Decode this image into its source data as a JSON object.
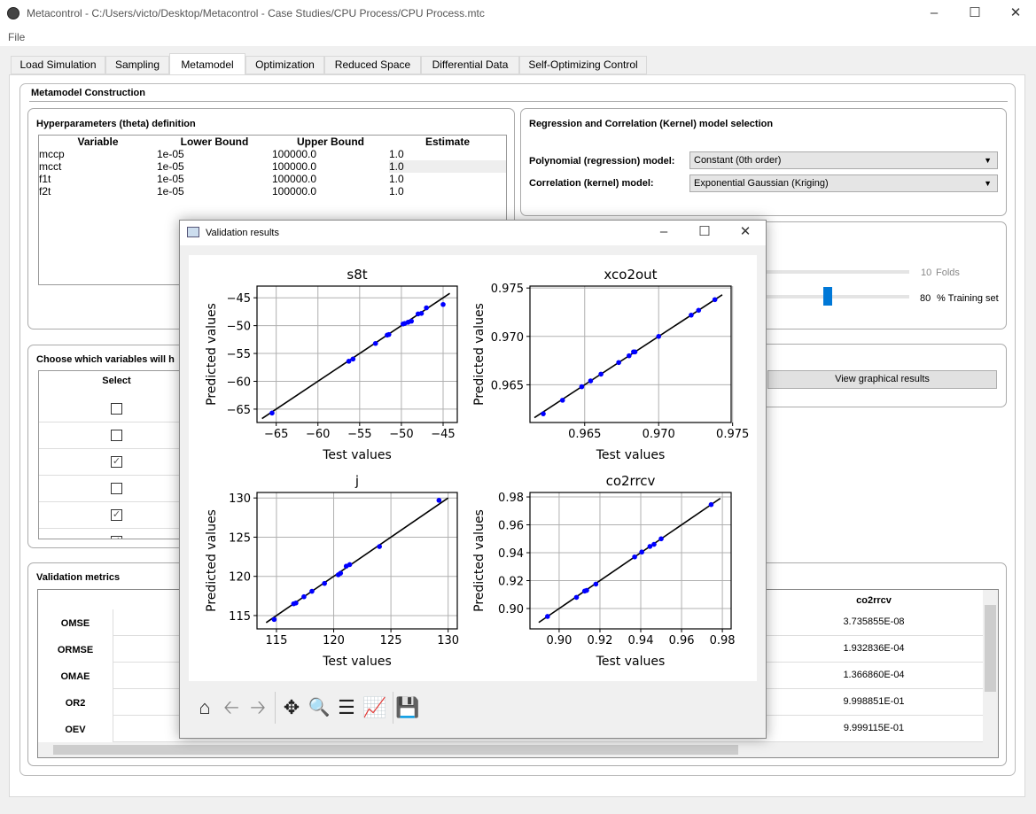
{
  "window": {
    "title": "Metacontrol - C:/Users/victo/Desktop/Metacontrol - Case Studies/CPU Process/CPU Process.mtc",
    "menu": [
      "File"
    ]
  },
  "tabs": [
    {
      "label": "Load Simulation"
    },
    {
      "label": "Sampling"
    },
    {
      "label": "Metamodel",
      "active": true
    },
    {
      "label": "Optimization"
    },
    {
      "label": "Reduced Space"
    },
    {
      "label": "Differential Data"
    },
    {
      "label": "Self-Optimizing Control"
    }
  ],
  "construction": {
    "title": "Metamodel Construction"
  },
  "hyper": {
    "title": "Hyperparameters (theta) definition",
    "headers": [
      "Variable",
      "Lower Bound",
      "Upper Bound",
      "Estimate"
    ],
    "rows": [
      [
        "mccp",
        "1e-05",
        "100000.0",
        "1.0"
      ],
      [
        "mcct",
        "1e-05",
        "100000.0",
        "1.0"
      ],
      [
        "f1t",
        "1e-05",
        "100000.0",
        "1.0"
      ],
      [
        "f2t",
        "1e-05",
        "100000.0",
        "1.0"
      ]
    ]
  },
  "model": {
    "title": "Regression and Correlation (Kernel) model selection",
    "poly_label": "Polynomial (regression) model:",
    "poly_value": "Constant (0th order)",
    "corr_label": "Correlation (kernel) model:",
    "corr_value": "Exponential Gaussian (Kriging)"
  },
  "validation_settings": {
    "folds_value": "10",
    "folds_label": "Folds",
    "training_value": "80",
    "training_label": "% Training set",
    "training_fraction": 80
  },
  "graphical": {
    "button": "View graphical results"
  },
  "choose": {
    "title": "Choose which variables will h",
    "header": "Select",
    "checked": [
      false,
      false,
      true,
      false,
      true,
      true
    ]
  },
  "metrics": {
    "title": "Validation metrics",
    "rows": [
      "OMSE",
      "ORMSE",
      "OMAE",
      "OR2",
      "OEV"
    ],
    "column": "co2rrcv",
    "values": [
      "3.735855E-08",
      "1.932836E-04",
      "1.366860E-04",
      "9.998851E-01",
      "9.999115E-01"
    ]
  },
  "dialog": {
    "title": "Validation results",
    "toolbar": [
      "home-icon",
      "back-icon",
      "forward-icon",
      "pan-icon",
      "zoom-icon",
      "configure-subplots-icon",
      "edit-axes-icon",
      "save-icon"
    ]
  },
  "chart_data": [
    {
      "type": "scatter",
      "title": "s8t",
      "xlabel": "Test values",
      "ylabel": "Predicted values",
      "xlim": [
        -67.3,
        -43.3
      ],
      "ylim": [
        -67.4,
        -42.9
      ],
      "xticks": [
        -65,
        -60,
        -55,
        -50,
        -45
      ],
      "yticks": [
        -65,
        -60,
        -55,
        -50,
        -45
      ],
      "grid": true,
      "point_color": "#0000ff",
      "line": [
        [
          -66.7,
          -66.7
        ],
        [
          -44.2,
          -44.2
        ]
      ],
      "points": [
        [
          -65.5,
          -65.7
        ],
        [
          -56.3,
          -56.4
        ],
        [
          -55.8,
          -56.0
        ],
        [
          -53.1,
          -53.2
        ],
        [
          -51.7,
          -51.7
        ],
        [
          -51.5,
          -51.6
        ],
        [
          -49.8,
          -49.7
        ],
        [
          -49.6,
          -49.6
        ],
        [
          -49.2,
          -49.4
        ],
        [
          -48.8,
          -49.2
        ],
        [
          -48.0,
          -47.9
        ],
        [
          -47.6,
          -47.8
        ],
        [
          -47.0,
          -46.8
        ],
        [
          -45.0,
          -46.2
        ]
      ]
    },
    {
      "type": "scatter",
      "title": "xco2out",
      "xlabel": "Test values",
      "ylabel": "Predicted values",
      "xlim": [
        0.9613,
        0.9749
      ],
      "ylim": [
        0.9611,
        0.9752
      ],
      "xticks": [
        0.965,
        0.97,
        0.975
      ],
      "yticks": [
        0.965,
        0.97,
        0.975
      ],
      "grid": true,
      "point_color": "#0000ff",
      "line": [
        [
          0.9616,
          0.9616
        ],
        [
          0.9743,
          0.9743
        ]
      ],
      "points": [
        [
          0.9622,
          0.962
        ],
        [
          0.9635,
          0.9634
        ],
        [
          0.9648,
          0.9648
        ],
        [
          0.9654,
          0.9654
        ],
        [
          0.9661,
          0.9661
        ],
        [
          0.9673,
          0.9673
        ],
        [
          0.968,
          0.968
        ],
        [
          0.9683,
          0.9684
        ],
        [
          0.9684,
          0.9684
        ],
        [
          0.97,
          0.97
        ],
        [
          0.9722,
          0.9722
        ],
        [
          0.9727,
          0.9727
        ],
        [
          0.9738,
          0.9738
        ]
      ]
    },
    {
      "type": "scatter",
      "title": "j",
      "xlabel": "Test values",
      "ylabel": "Predicted values",
      "xlim": [
        113.3,
        130.8
      ],
      "ylim": [
        113.3,
        130.7
      ],
      "xticks": [
        115,
        120,
        125,
        130
      ],
      "yticks": [
        115,
        120,
        125,
        130
      ],
      "grid": true,
      "point_color": "#0000ff",
      "line": [
        [
          114.1,
          114.1
        ],
        [
          130,
          130
        ]
      ],
      "points": [
        [
          114.8,
          114.5
        ],
        [
          116.5,
          116.5
        ],
        [
          116.7,
          116.6
        ],
        [
          117.4,
          117.4
        ],
        [
          118.1,
          118.1
        ],
        [
          119.2,
          119.1
        ],
        [
          120.4,
          120.2
        ],
        [
          120.6,
          120.4
        ],
        [
          121.1,
          121.3
        ],
        [
          121.4,
          121.5
        ],
        [
          124.0,
          123.8
        ],
        [
          129.2,
          129.7
        ]
      ]
    },
    {
      "type": "scatter",
      "title": "co2rrcv",
      "xlabel": "Test values",
      "ylabel": "Predicted values",
      "xlim": [
        0.8857,
        0.9843
      ],
      "ylim": [
        0.8854,
        0.9832
      ],
      "xticks": [
        0.9,
        0.92,
        0.94,
        0.96,
        0.98
      ],
      "yticks": [
        0.9,
        0.92,
        0.94,
        0.96,
        0.98
      ],
      "grid": true,
      "point_color": "#0000ff",
      "line": [
        [
          0.89,
          0.89
        ],
        [
          0.979,
          0.979
        ]
      ],
      "points": [
        [
          0.8943,
          0.8943
        ],
        [
          0.9085,
          0.908
        ],
        [
          0.9125,
          0.9125
        ],
        [
          0.9135,
          0.913
        ],
        [
          0.918,
          0.9175
        ],
        [
          0.937,
          0.937
        ],
        [
          0.9405,
          0.9405
        ],
        [
          0.9445,
          0.9445
        ],
        [
          0.9465,
          0.946
        ],
        [
          0.95,
          0.95
        ],
        [
          0.9745,
          0.9745
        ]
      ]
    }
  ]
}
